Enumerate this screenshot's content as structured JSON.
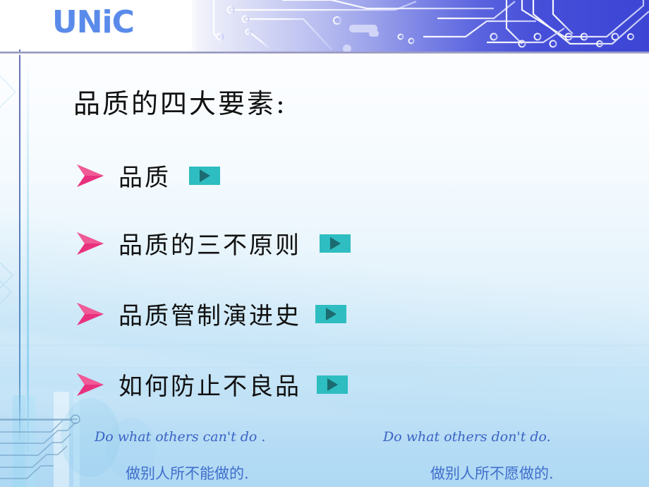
{
  "slide": {
    "logo": "UNiC",
    "title": "品质的四大要素:",
    "bullets": [
      {
        "marker": "arrowhead-bullet",
        "label": "品质",
        "action_icon": "play-icon"
      },
      {
        "marker": "arrowhead-bullet",
        "label": "品质的三不原则",
        "action_icon": "play-icon"
      },
      {
        "marker": "arrowhead-bullet",
        "label": "品质管制演进史",
        "action_icon": "play-icon"
      },
      {
        "marker": "arrowhead-bullet",
        "label": "如何防止不良品",
        "action_icon": "play-icon"
      }
    ],
    "footer": {
      "left_en": "Do what others  can't do .",
      "left_cn": "做别人所不能做的.",
      "right_en": "Do what others don't do.",
      "right_cn": "做别人所不愿做的."
    },
    "colors": {
      "logo_blue": "#5b8bea",
      "header_deep_blue": "#3d46d4",
      "bullet_pink": "#e8317e",
      "play_teal": "#2ebdc0",
      "play_triangle": "#1b6b70",
      "footer_blue": "#3a63c4",
      "rule_purple": "#8d8fbb",
      "background_bottom": "#aed8f4"
    }
  }
}
